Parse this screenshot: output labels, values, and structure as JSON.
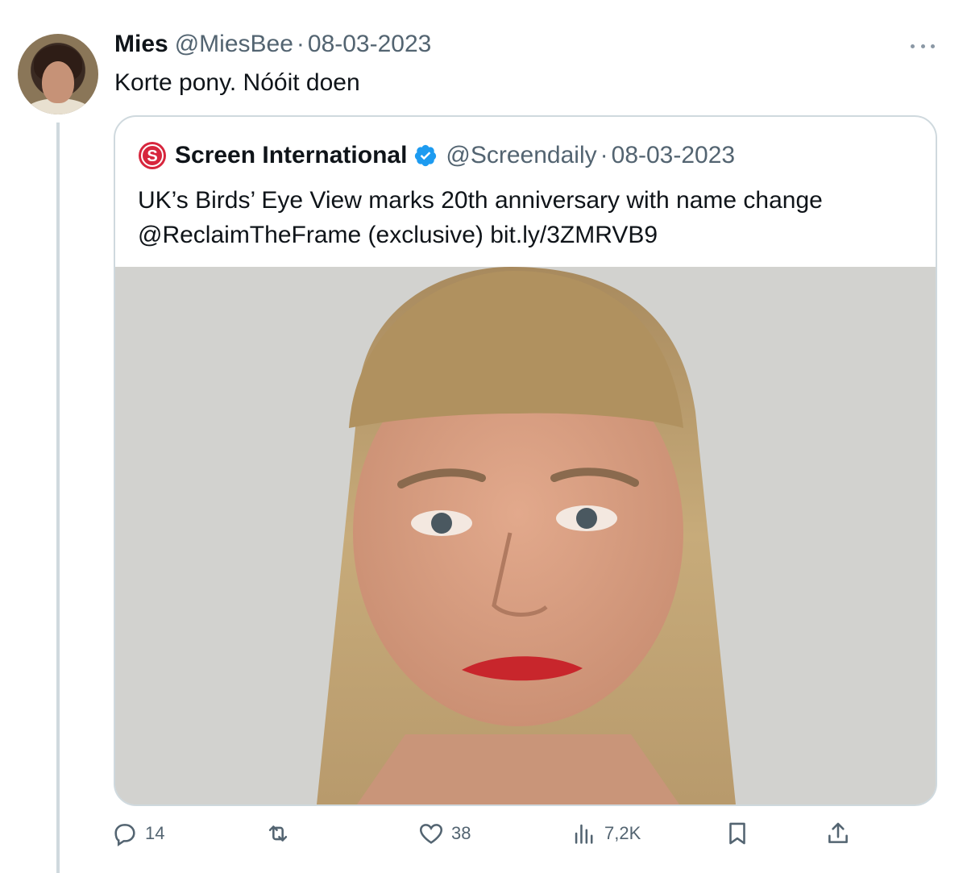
{
  "tweet": {
    "display_name": "Mies",
    "handle": "@MiesBee",
    "separator": "·",
    "date": "08-03-2023",
    "text": "Korte pony. Nóóit doen"
  },
  "quote": {
    "display_name": "Screen International",
    "handle": "@Screendaily",
    "separator": "·",
    "date": "08-03-2023",
    "text_lines": [
      "UK’s Birds’ Eye View marks 20th anniversary with name change",
      "@ReclaimTheFrame (exclusive) bit.ly/3ZMRVB9"
    ],
    "brand_color": "#d7263d",
    "verified_color": "#1d9bf0"
  },
  "actions": {
    "replies": "14",
    "retweets": "",
    "likes": "38",
    "views": "7,2K"
  },
  "icons": {
    "more": "more-horizontal-icon",
    "reply": "reply-icon",
    "retweet": "retweet-icon",
    "like": "heart-icon",
    "views": "views-chart-icon",
    "bookmark": "bookmark-icon",
    "share": "share-icon",
    "verified": "verified-badge-icon",
    "brand": "screen-international-logo"
  }
}
